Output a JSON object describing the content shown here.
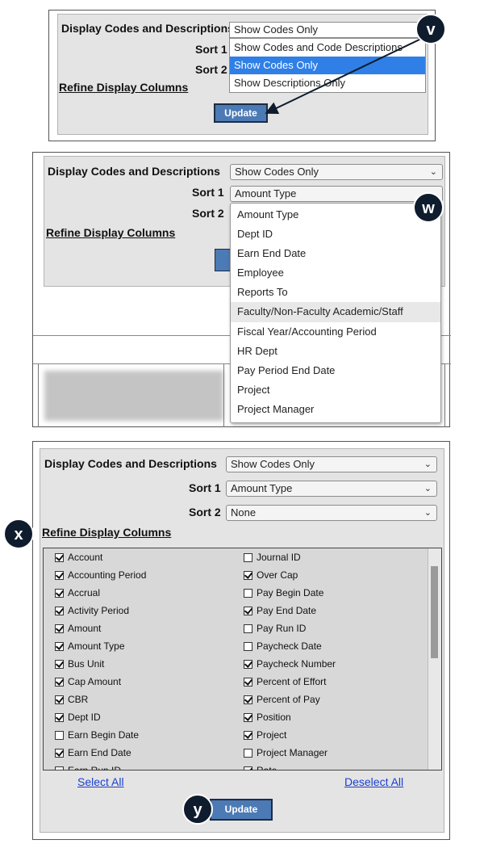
{
  "markers": {
    "v": "v",
    "w": "w",
    "x": "x",
    "y": "y"
  },
  "panel1": {
    "display_label": "Display Codes and Descriptions",
    "display_value": "Show Codes Only",
    "sort1_label": "Sort 1",
    "sort2_label": "Sort 2",
    "refine_label": "Refine Display Columns",
    "dropdown_options": [
      "Show Codes and Code Descriptions",
      "Show Codes Only",
      "Show Descriptions Only"
    ],
    "selected_option": "Show Codes Only",
    "update_label": "Update"
  },
  "panel2": {
    "display_label": "Display Codes and Descriptions",
    "display_value": "Show Codes Only",
    "sort1_label": "Sort 1",
    "sort1_value": "Amount Type",
    "sort2_label": "Sort 2",
    "refine_label": "Refine Display Columns",
    "dropdown_options": [
      "Amount Type",
      "Dept ID",
      "Earn End Date",
      "Employee",
      "Reports To",
      "Faculty/Non-Faculty Academic/Staff",
      "Fiscal Year/Accounting Period",
      "HR Dept",
      "Pay Period End Date",
      "Project",
      "Project Manager"
    ],
    "hover_option": "Faculty/Non-Faculty Academic/Staff"
  },
  "panel3": {
    "display_label": "Display Codes and Descriptions",
    "display_value": "Show Codes Only",
    "sort1_label": "Sort 1",
    "sort1_value": "Amount Type",
    "sort2_label": "Sort 2",
    "sort2_value": "None",
    "refine_label": "Refine Display Columns",
    "left_columns": [
      {
        "label": "Account",
        "checked": true
      },
      {
        "label": "Accounting Period",
        "checked": true
      },
      {
        "label": "Accrual",
        "checked": true
      },
      {
        "label": "Activity Period",
        "checked": true
      },
      {
        "label": "Amount",
        "checked": true
      },
      {
        "label": "Amount Type",
        "checked": true
      },
      {
        "label": "Bus Unit",
        "checked": true
      },
      {
        "label": "Cap Amount",
        "checked": true
      },
      {
        "label": "CBR",
        "checked": true
      },
      {
        "label": "Dept ID",
        "checked": true
      },
      {
        "label": "Earn Begin Date",
        "checked": false
      },
      {
        "label": "Earn End Date",
        "checked": true
      },
      {
        "label": "Earn Run ID",
        "checked": false
      }
    ],
    "right_columns": [
      {
        "label": "Journal ID",
        "checked": false
      },
      {
        "label": "Over Cap",
        "checked": true
      },
      {
        "label": "Pay Begin Date",
        "checked": false
      },
      {
        "label": "Pay End Date",
        "checked": true
      },
      {
        "label": "Pay Run ID",
        "checked": false
      },
      {
        "label": "Paycheck Date",
        "checked": false
      },
      {
        "label": "Paycheck Number",
        "checked": true
      },
      {
        "label": "Percent of Effort",
        "checked": true
      },
      {
        "label": "Percent of Pay",
        "checked": true
      },
      {
        "label": "Position",
        "checked": true
      },
      {
        "label": "Project",
        "checked": true
      },
      {
        "label": "Project Manager",
        "checked": false
      },
      {
        "label": "Rate",
        "checked": true
      }
    ],
    "select_all": "Select All",
    "deselect_all": "Deselect All",
    "update_label": "Update"
  }
}
